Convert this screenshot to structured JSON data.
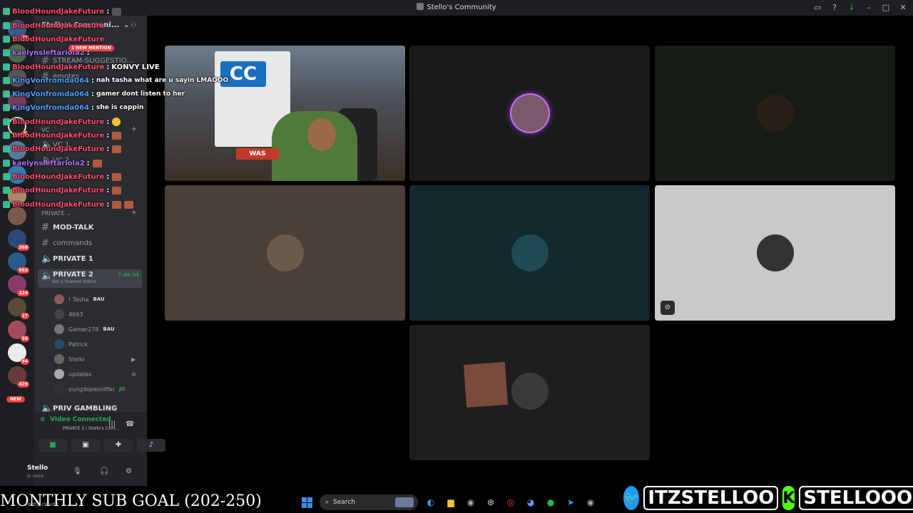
{
  "window": {
    "title": "Stello's Community"
  },
  "titlebar_icons": [
    "screen-share-icon",
    "help-icon",
    "download-icon",
    "minimize-icon",
    "maximize-icon",
    "close-icon"
  ],
  "rail": {
    "badges": [
      "25",
      "5",
      "368",
      "663",
      "224",
      "27",
      "56",
      "94",
      "429"
    ],
    "new_label": "NEW"
  },
  "sidebar": {
    "server_name": "Stello's Communi...",
    "partial_channels": [
      "STREAM-SUGGESTIO...",
      "emotes"
    ],
    "categories": {
      "vc": "VC",
      "private": "PRIVATE"
    },
    "vc_channels": [
      "VC 1",
      "VC 2"
    ],
    "private_channels": [
      {
        "name": "MOD-TALK",
        "type": "text",
        "bold": true
      },
      {
        "name": "commands",
        "type": "text",
        "bold": false
      },
      {
        "name": "PRIVATE 1",
        "type": "voice",
        "bold": true
      }
    ],
    "active_channel": {
      "name": "PRIVATE 2",
      "timer": "7:49:58",
      "status": "Set a channel status"
    },
    "members": [
      {
        "name": "! Tasha",
        "tag": "BAU"
      },
      {
        "name": "4693",
        "tag": ""
      },
      {
        "name": "Gamer278",
        "tag": "BAU"
      },
      {
        "name": "Patrick",
        "tag": ""
      },
      {
        "name": "Stello",
        "tag": ""
      },
      {
        "name": "updates",
        "tag": ""
      },
      {
        "name": "yungdopesniffer",
        "tag": "JO"
      }
    ],
    "next_channel": "PRIV GAMBLING"
  },
  "voice_panel": {
    "status": "Video Connected",
    "location": "PRIVATE 2 / Stello's Com...",
    "user_name": "Stello",
    "user_status": "In voice"
  },
  "chat": {
    "new_mention": "1 NEW MENTION",
    "messages": [
      {
        "user": "BloodHoundJakeFuture",
        "color": "red",
        "text": ""
      },
      {
        "user": "BloodHoundJakeFuture",
        "color": "red",
        "text": ""
      },
      {
        "user": "BloodHoundJakeFuture",
        "color": "red",
        "text": ""
      },
      {
        "user": "kaelynsleftariola2",
        "color": "purple",
        "text": ""
      },
      {
        "user": "BloodHoundJakeFuture",
        "color": "red",
        "text": "KONVY LIVE"
      },
      {
        "user": "KingVonfromda064",
        "color": "blue",
        "text": "nah tasha what are u sayin LMAOOO"
      },
      {
        "user": "KingVonfromda064",
        "color": "blue",
        "text": "gamer dont listen to her"
      },
      {
        "user": "KingVonfromda064",
        "color": "blue",
        "text": "she is cappin"
      },
      {
        "user": "BloodHoundJakeFuture",
        "color": "red",
        "text": ""
      },
      {
        "user": "BloodHoundJakeFuture",
        "color": "red",
        "text": ""
      },
      {
        "user": "BloodHoundJakeFuture",
        "color": "red",
        "text": ""
      },
      {
        "user": "kaelynsleftariola2",
        "color": "purple",
        "text": ""
      },
      {
        "user": "BloodHoundJakeFuture",
        "color": "red",
        "text": ""
      },
      {
        "user": "BloodHoundJakeFuture",
        "color": "red",
        "text": ""
      },
      {
        "user": "BloodHoundJakeFuture",
        "color": "red",
        "text": ""
      }
    ]
  },
  "video": {
    "cam_logo": "CC",
    "cam_sign": "WAS"
  },
  "overlay": {
    "sub_goal": "MONTHLY SUB GOAL (202-250)",
    "weather": "Partly cloudy",
    "twitter_handle": "ITZSTELLOO",
    "kick_handle": "STELLOOO",
    "kick_letter": "K"
  },
  "taskbar": {
    "search_placeholder": "Search"
  },
  "colors": {
    "accent_green": "#23a55a",
    "mention_red": "#f23f43",
    "background": "#000000",
    "sidebar": "#2b2d31"
  }
}
